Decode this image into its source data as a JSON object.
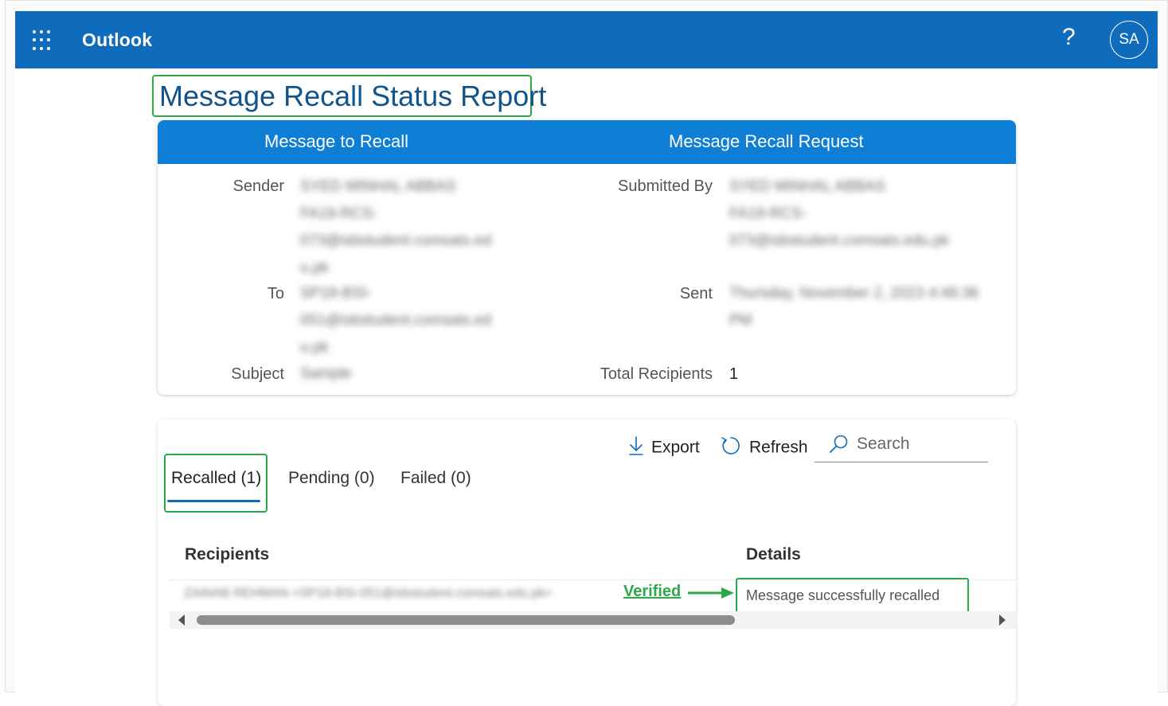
{
  "app": {
    "title": "Outlook",
    "help_label": "?",
    "avatar_initials": "SA"
  },
  "page": {
    "title": "Message Recall Status Report"
  },
  "summary": {
    "col1_header": "Message to Recall",
    "col2_header": "Message Recall Request",
    "sender_label": "Sender",
    "sender_value_lines": [
      "SYED MINHAL ABBAS",
      "FA19-RCS-",
      "073@isbstudent.comsats.ed",
      "u.pk"
    ],
    "to_label": "To",
    "to_value_lines": [
      "SP18-BSI-",
      "051@isbstudent.comsats.ed",
      "u.pk"
    ],
    "subject_label": "Subject",
    "subject_value": "Sample",
    "submitted_by_label": "Submitted By",
    "submitted_by_value_lines": [
      "SYED MINHAL ABBAS",
      "FA19-RCS-",
      "073@isbstudent.comsats.edu.pk"
    ],
    "sent_label": "Sent",
    "sent_value_lines": [
      "Thursday, November 2, 2023 4:46:36",
      "PM"
    ],
    "total_recipients_label": "Total Recipients",
    "total_recipients_value": "1"
  },
  "toolbar": {
    "export_label": "Export",
    "refresh_label": "Refresh",
    "search_placeholder": "Search"
  },
  "tabs": [
    {
      "label": "Recalled (1)",
      "active": true
    },
    {
      "label": "Pending (0)",
      "active": false
    },
    {
      "label": "Failed (0)",
      "active": false
    }
  ],
  "table": {
    "headers": [
      "Recipients",
      "Details"
    ],
    "rows": [
      {
        "recipient": "ZAINAB REHMAN <SP18-BSI-051@isbstudent.comsats.edu.pk>",
        "details": "Message successfully recalled"
      }
    ]
  },
  "annotation": {
    "label": "Verified",
    "color": "#2fa84a"
  },
  "colors": {
    "topbar": "#0f6cbd",
    "card_header": "#0f7fd6",
    "highlight": "#2fa84a",
    "title": "#0f548c"
  }
}
